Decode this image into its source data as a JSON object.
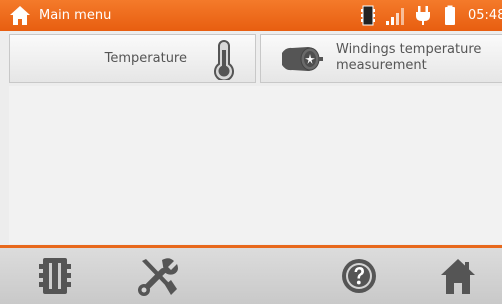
{
  "header": {
    "title": "Main menu",
    "time": "05:48",
    "icons": [
      "home-icon",
      "memory-card-icon",
      "signal-icon",
      "plug-icon",
      "battery-icon"
    ]
  },
  "menu": {
    "items": [
      {
        "label": "Temperature",
        "icon": "thermometer-icon"
      },
      {
        "label_lines": [
          "Windings temperature",
          "measurement"
        ],
        "icon": "motor-icon"
      }
    ]
  },
  "toolbar": {
    "buttons": [
      "memory-icon",
      "settings-tools-icon",
      "help-icon",
      "home-icon"
    ]
  },
  "colors": {
    "accent": "#e8691c",
    "icon_gray": "#555555",
    "tile_background": "#f0f0f0"
  }
}
